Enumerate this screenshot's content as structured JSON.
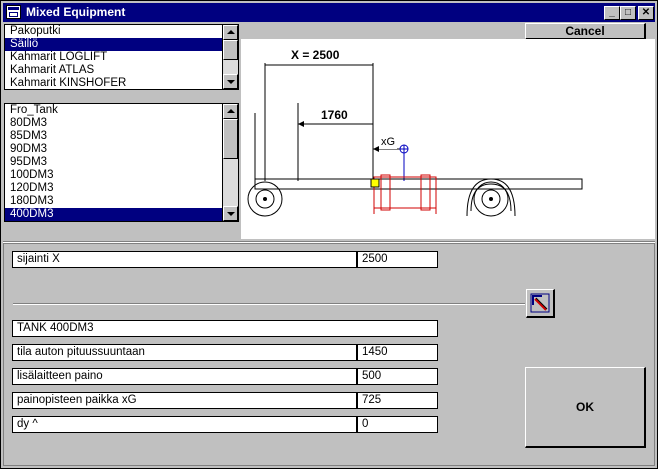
{
  "window": {
    "title": "Mixed Equipment",
    "controls": {
      "minimize": "_",
      "maximize": "□",
      "close": "✕"
    }
  },
  "buttons": {
    "cancel": "Cancel",
    "ok": "OK"
  },
  "category_list": {
    "items": [
      "Pakoputki",
      "Säiliö",
      "Kahmarit LOGLIFT",
      "Kahmarit ATLAS",
      "Kahmarit KINSHOFER"
    ],
    "selected_index": 1
  },
  "size_list": {
    "items": [
      "Fro_Tank",
      "80DM3",
      "85DM3",
      "90DM3",
      "95DM3",
      "100DM3",
      "120DM3",
      "180DM3",
      "400DM3"
    ],
    "selected_index": 8
  },
  "diagram": {
    "dim_x_label": "X = 2500",
    "dim_inner_label": "1760",
    "xg_label": "xG",
    "colors": {
      "line": "#000000",
      "tank": "#d00000",
      "marker": "#ffff00",
      "cog": "#0000c0"
    }
  },
  "fields": {
    "sijainti": {
      "label": "sijainti   X",
      "value": "2500"
    },
    "equipment_name": "TANK  400DM3",
    "tila": {
      "label": "tila auton pituussuuntaan",
      "value": "1450"
    },
    "paino": {
      "label": "lisälaitteen paino",
      "value": "500"
    },
    "painopiste": {
      "label": "painopisteen paikka  xG",
      "value": "725"
    },
    "dy": {
      "label": "dy   ^",
      "value": "0"
    }
  },
  "icons": {
    "pick": "pick-position-icon",
    "app": "app-window-icon"
  }
}
